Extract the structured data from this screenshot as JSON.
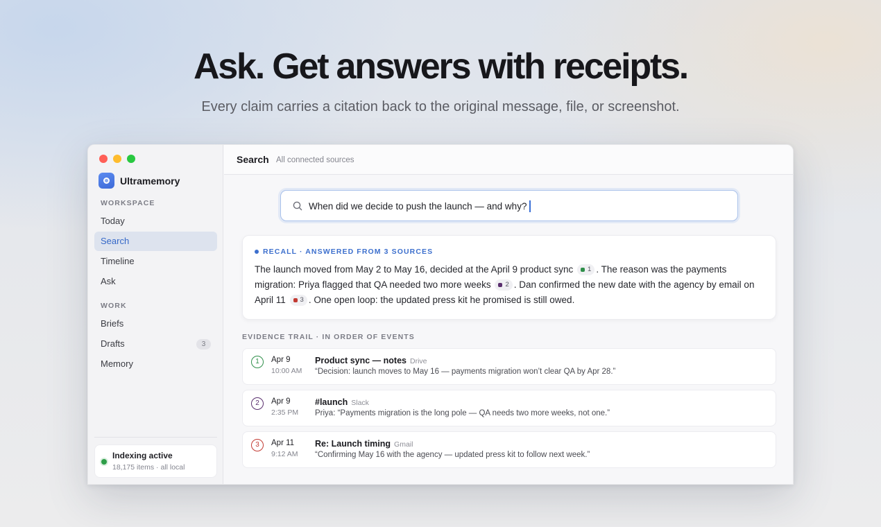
{
  "hero": {
    "title": "Ask. Get answers with receipts.",
    "subtitle": "Every claim carries a citation back to the original message, file, or screenshot."
  },
  "sidebar": {
    "app_name": "Ultramemory",
    "workspace_label": "WORKSPACE",
    "workspace_items": [
      {
        "label": "Today",
        "active": false
      },
      {
        "label": "Search",
        "active": true
      },
      {
        "label": "Timeline",
        "active": false
      },
      {
        "label": "Ask",
        "active": false
      }
    ],
    "work_label": "WORK",
    "work_items": [
      {
        "label": "Briefs"
      },
      {
        "label": "Drafts",
        "count": "3"
      },
      {
        "label": "Memory"
      }
    ],
    "status": {
      "title": "Indexing active",
      "subtitle": "18,175 items · all local",
      "color": "#2e9e48"
    }
  },
  "topbar": {
    "title": "Search",
    "subtitle": "All connected sources"
  },
  "search": {
    "query": "When did we decide to push the launch — and why?",
    "icon": "search-icon"
  },
  "answer": {
    "label": "RECALL · ANSWERED FROM 3 SOURCES",
    "part1": "The launch moved from May 2 to May 16, decided at the April 9 product sync",
    "cite1": "1",
    "part2": ". The reason was the payments migration: Priya flagged that QA needed two more weeks",
    "cite2": "2",
    "part3": ". Dan confirmed the new date with the agency by email on April 11",
    "cite3": "3",
    "part4": ". One open loop: the updated press kit he promised is still owed.",
    "accent": "#3c6fcd"
  },
  "evidence": {
    "label": "EVIDENCE TRAIL · IN ORDER OF EVENTS",
    "items": [
      {
        "num": "1",
        "date": "Apr 9",
        "time": "10:00 AM",
        "title": "Product sync — notes",
        "source": "Drive",
        "quote": "“Decision: launch moves to May 16 — payments migration won’t clear QA by Apr 28.”",
        "color": "#2f8f4a"
      },
      {
        "num": "2",
        "date": "Apr 9",
        "time": "2:35 PM",
        "title": "#launch",
        "source": "Slack",
        "quote": "Priya: “Payments migration is the long pole — QA needs two more weeks, not one.”",
        "color": "#5a2f6e"
      },
      {
        "num": "3",
        "date": "Apr 11",
        "time": "9:12 AM",
        "title": "Re: Launch timing",
        "source": "Gmail",
        "quote": "“Confirming May 16 with the agency — updated press kit to follow next week.”",
        "color": "#c23a32"
      }
    ]
  }
}
